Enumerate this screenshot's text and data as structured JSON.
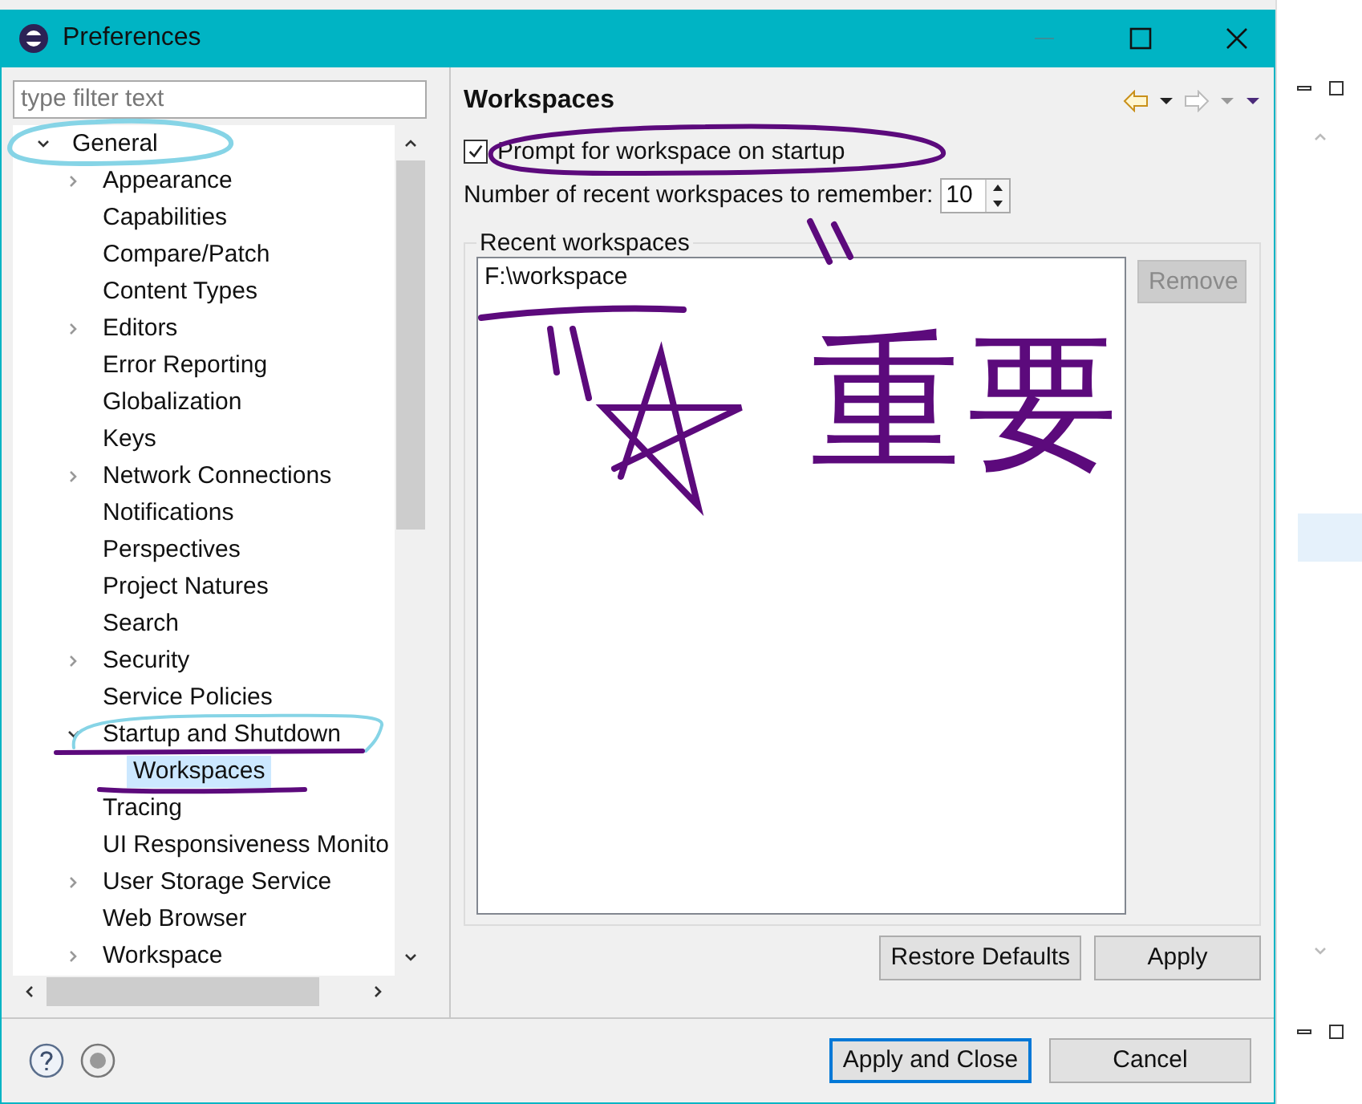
{
  "window": {
    "title": "Preferences"
  },
  "filter": {
    "placeholder": "type filter text"
  },
  "tree": [
    {
      "label": "General",
      "kind": "node",
      "expanded": true,
      "selected": false,
      "children": [
        {
          "label": "Appearance",
          "kind": "node",
          "expanded": false,
          "selected": false
        },
        {
          "label": "Capabilities",
          "kind": "leaf",
          "expanded": false,
          "selected": false
        },
        {
          "label": "Compare/Patch",
          "kind": "leaf",
          "expanded": false,
          "selected": false
        },
        {
          "label": "Content Types",
          "kind": "leaf",
          "expanded": false,
          "selected": false
        },
        {
          "label": "Editors",
          "kind": "node",
          "expanded": false,
          "selected": false
        },
        {
          "label": "Error Reporting",
          "kind": "leaf",
          "expanded": false,
          "selected": false
        },
        {
          "label": "Globalization",
          "kind": "leaf",
          "expanded": false,
          "selected": false
        },
        {
          "label": "Keys",
          "kind": "leaf",
          "expanded": false,
          "selected": false
        },
        {
          "label": "Network Connections",
          "kind": "node",
          "expanded": false,
          "selected": false
        },
        {
          "label": "Notifications",
          "kind": "leaf",
          "expanded": false,
          "selected": false
        },
        {
          "label": "Perspectives",
          "kind": "leaf",
          "expanded": false,
          "selected": false
        },
        {
          "label": "Project Natures",
          "kind": "leaf",
          "expanded": false,
          "selected": false
        },
        {
          "label": "Search",
          "kind": "leaf",
          "expanded": false,
          "selected": false
        },
        {
          "label": "Security",
          "kind": "node",
          "expanded": false,
          "selected": false
        },
        {
          "label": "Service Policies",
          "kind": "leaf",
          "expanded": false,
          "selected": false
        },
        {
          "label": "Startup and Shutdown",
          "kind": "node",
          "expanded": true,
          "selected": false,
          "children": [
            {
              "label": "Workspaces",
              "kind": "leaf",
              "expanded": false,
              "selected": true
            }
          ]
        },
        {
          "label": "Tracing",
          "kind": "leaf",
          "expanded": false,
          "selected": false
        },
        {
          "label": "UI Responsiveness Monito",
          "kind": "leaf",
          "expanded": false,
          "selected": false
        },
        {
          "label": "User Storage Service",
          "kind": "node",
          "expanded": false,
          "selected": false
        },
        {
          "label": "Web Browser",
          "kind": "leaf",
          "expanded": false,
          "selected": false
        },
        {
          "label": "Workspace",
          "kind": "node",
          "expanded": false,
          "selected": false
        }
      ]
    }
  ],
  "page": {
    "title": "Workspaces",
    "prompt": {
      "label": "Prompt for workspace on startup",
      "checked": true
    },
    "recent_count": {
      "label": "Number of recent workspaces to remember:",
      "value": "10"
    },
    "recent_group": {
      "title": "Recent workspaces",
      "items": [
        {
          "label": "F:\\workspace",
          "selected": false
        }
      ],
      "remove_button": {
        "label": "Remove",
        "disabled": true
      }
    },
    "buttons": [
      {
        "label": "Restore Defaults"
      },
      {
        "label": "Apply"
      }
    ]
  },
  "dialog_buttons": [
    {
      "label": "Apply and Close",
      "focused": true
    },
    {
      "label": "Cancel",
      "focused": false
    }
  ],
  "annotation": {
    "text": "重要"
  }
}
